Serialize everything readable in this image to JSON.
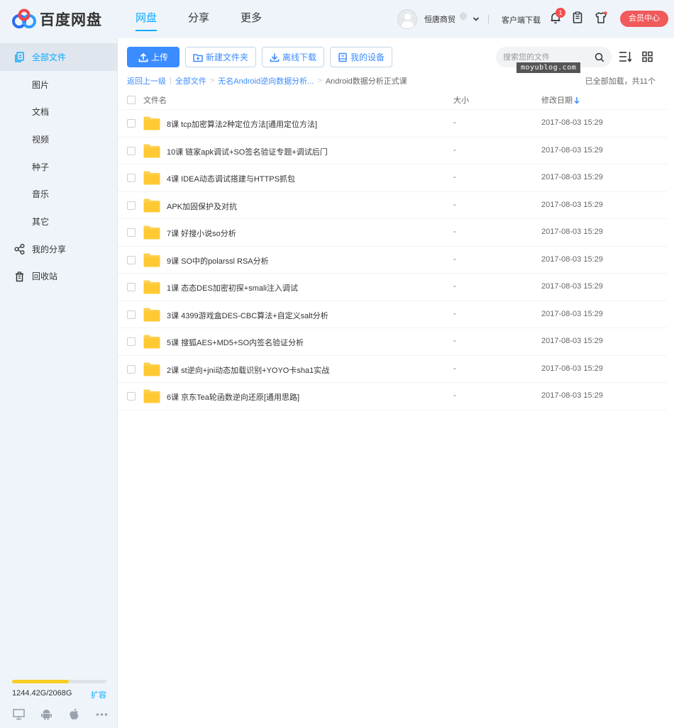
{
  "header": {
    "logo_text": "百度网盘",
    "nav": [
      {
        "label": "网盘",
        "active": true
      },
      {
        "label": "分享",
        "active": false
      },
      {
        "label": "更多",
        "active": false
      }
    ],
    "username": "恒唐商贸",
    "client_download": "客户端下载",
    "notification_count": "1",
    "vip_center": "会员中心"
  },
  "sidebar": {
    "items": [
      {
        "label": "全部文件",
        "icon": "files-icon",
        "active": true
      },
      {
        "label": "图片",
        "icon": "",
        "active": false
      },
      {
        "label": "文档",
        "icon": "",
        "active": false
      },
      {
        "label": "视频",
        "icon": "",
        "active": false
      },
      {
        "label": "种子",
        "icon": "",
        "active": false
      },
      {
        "label": "音乐",
        "icon": "",
        "active": false
      },
      {
        "label": "其它",
        "icon": "",
        "active": false
      },
      {
        "label": "我的分享",
        "icon": "share-icon",
        "active": false
      },
      {
        "label": "回收站",
        "icon": "trash-icon",
        "active": false
      }
    ],
    "quota": {
      "used_text": "1244.42G/2068G",
      "fraction": 0.602,
      "expand": "扩容"
    }
  },
  "toolbar": {
    "upload": "上传",
    "new_folder": "新建文件夹",
    "offline_download": "离线下载",
    "my_devices": "我的设备"
  },
  "search": {
    "placeholder": "搜索您的文件"
  },
  "watermark": "moyublog.com",
  "breadcrumb": {
    "back": "返回上一级",
    "root": "全部文件",
    "parent": "无名Android逆向数据分析...",
    "current": "Android数据分析正式课",
    "loaded": "已全部加载，共11个"
  },
  "table": {
    "headers": {
      "name": "文件名",
      "size": "大小",
      "date": "修改日期"
    },
    "rows": [
      {
        "name": "8课 tcp加密算法2种定位方法[通用定位方法]",
        "size": "-",
        "date": "2017-08-03 15:29"
      },
      {
        "name": "10课 链家apk调试+SO签名验证专题+调试后门",
        "size": "-",
        "date": "2017-08-03 15:29"
      },
      {
        "name": "4课 IDEA动态调试搭建与HTTPS抓包",
        "size": "-",
        "date": "2017-08-03 15:29"
      },
      {
        "name": "APK加固保护及对抗",
        "size": "-",
        "date": "2017-08-03 15:29"
      },
      {
        "name": "7课 好搜小说so分析",
        "size": "-",
        "date": "2017-08-03 15:29"
      },
      {
        "name": "9课 SO中的polarssl RSA分析",
        "size": "-",
        "date": "2017-08-03 15:29"
      },
      {
        "name": "1课 态态DES加密初探+smali注入调试",
        "size": "-",
        "date": "2017-08-03 15:29"
      },
      {
        "name": "3课 4399游戏盒DES-CBC算法+自定义salt分析",
        "size": "-",
        "date": "2017-08-03 15:29"
      },
      {
        "name": "5课 搜狐AES+MD5+SO内签名验证分析",
        "size": "-",
        "date": "2017-08-03 15:29"
      },
      {
        "name": "2课 st逆向+jni动态加载识别+YOYO卡sha1实战",
        "size": "-",
        "date": "2017-08-03 15:29"
      },
      {
        "name": "6课 京东Tea轮函数逆向还原[通用思路]",
        "size": "-",
        "date": "2017-08-03 15:29"
      }
    ]
  },
  "colors": {
    "accent": "#09aaff",
    "primary_button": "#3b8cff",
    "vip": "#f05a5a",
    "folder": "#ffd04f",
    "quota_fill": "#f9cd21"
  }
}
